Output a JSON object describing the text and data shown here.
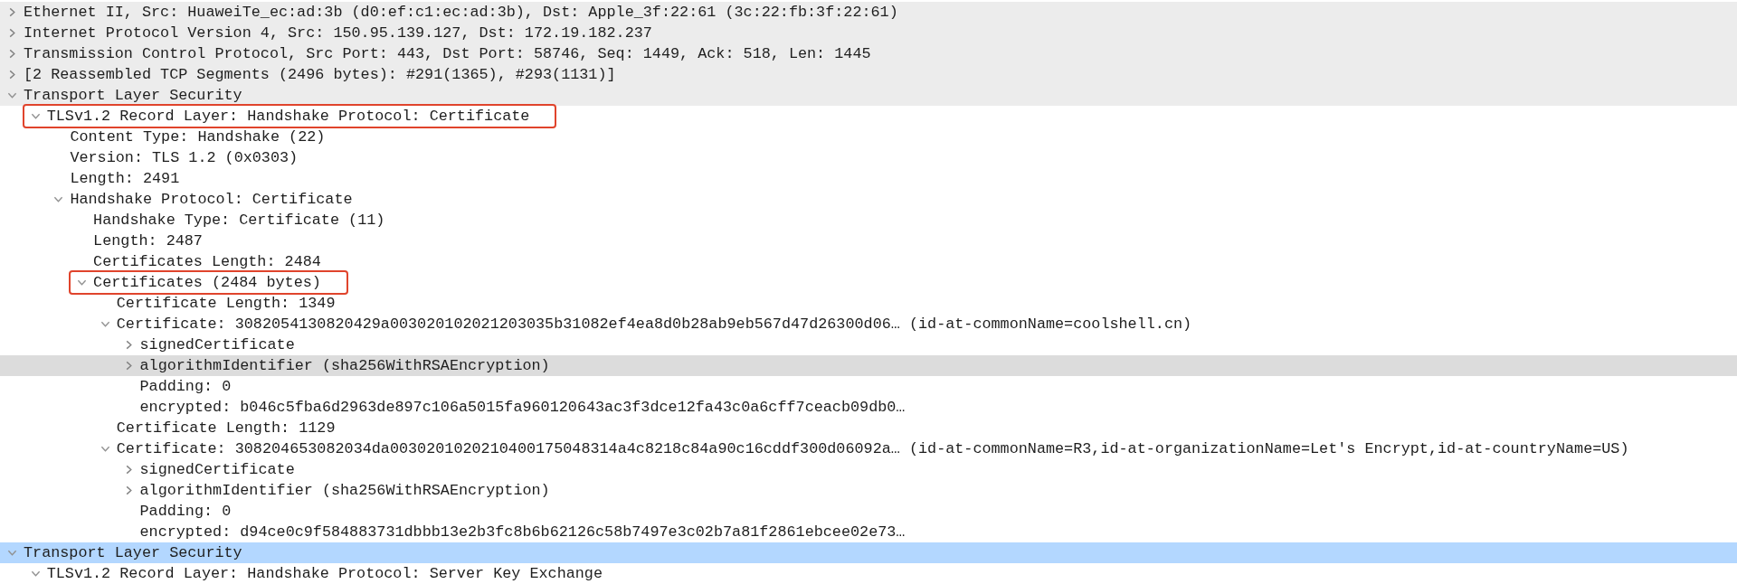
{
  "tree": [
    {
      "text": "Ethernet II, Src: HuaweiTe_ec:ad:3b (d0:ef:c1:ec:ad:3b), Dst: Apple_3f:22:61 (3c:22:fb:3f:22:61)",
      "expanded": false,
      "selected": false
    },
    {
      "text": "Internet Protocol Version 4, Src: 150.95.139.127, Dst: 172.19.182.237",
      "expanded": false,
      "selected": false
    },
    {
      "text": "Transmission Control Protocol, Src Port: 443, Dst Port: 58746, Seq: 1449, Ack: 518, Len: 1445",
      "expanded": false,
      "selected": false
    },
    {
      "text": "[2 Reassembled TCP Segments (2496 bytes): #291(1365), #293(1131)]",
      "expanded": false,
      "selected": false
    },
    {
      "text": "Transport Layer Security",
      "expanded": true,
      "selected": false,
      "children": [
        {
          "text": "TLSv1.2 Record Layer: Handshake Protocol: Certificate",
          "expanded": true,
          "selected": false,
          "annotated": true,
          "children": [
            {
              "text": "Content Type: Handshake (22)",
              "selected": false
            },
            {
              "text": "Version: TLS 1.2 (0x0303)",
              "selected": false
            },
            {
              "text": "Length: 2491",
              "selected": false
            },
            {
              "text": "Handshake Protocol: Certificate",
              "expanded": true,
              "selected": false,
              "children": [
                {
                  "text": "Handshake Type: Certificate (11)",
                  "selected": false
                },
                {
                  "text": "Length: 2487",
                  "selected": false
                },
                {
                  "text": "Certificates Length: 2484",
                  "selected": false
                },
                {
                  "text": "Certificates (2484 bytes)",
                  "expanded": true,
                  "selected": false,
                  "annotated": true,
                  "children": [
                    {
                      "text": "Certificate Length: 1349",
                      "selected": false
                    },
                    {
                      "text": "Certificate: 3082054130820429a003020102021203035b31082ef4ea8d0b28ab9eb567d47d26300d06… (id-at-commonName=coolshell.cn)",
                      "expanded": true,
                      "selected": false,
                      "children": [
                        {
                          "text": "signedCertificate",
                          "expanded": false,
                          "selected": false
                        },
                        {
                          "text": "algorithmIdentifier (sha256WithRSAEncryption)",
                          "expanded": false,
                          "selected": false,
                          "highlighted": true
                        },
                        {
                          "text": "Padding: 0",
                          "selected": false
                        },
                        {
                          "text": "encrypted: b046c5fba6d2963de897c106a5015fa960120643ac3f3dce12fa43c0a6cff7ceacb09db0…",
                          "selected": false
                        }
                      ]
                    },
                    {
                      "text": "Certificate Length: 1129",
                      "selected": false
                    },
                    {
                      "text": "Certificate: 308204653082034da0030201020210400175048314a4c8218c84a90c16cddf300d06092a… (id-at-commonName=R3,id-at-organizationName=Let's Encrypt,id-at-countryName=US)",
                      "expanded": true,
                      "selected": false,
                      "children": [
                        {
                          "text": "signedCertificate",
                          "expanded": false,
                          "selected": false
                        },
                        {
                          "text": "algorithmIdentifier (sha256WithRSAEncryption)",
                          "expanded": false,
                          "selected": false
                        },
                        {
                          "text": "Padding: 0",
                          "selected": false
                        },
                        {
                          "text": "encrypted: d94ce0c9f584883731dbbb13e2b3fc8b6b62126c58b7497e3c02b7a81f2861ebcee02e73…",
                          "selected": false
                        }
                      ]
                    }
                  ]
                }
              ]
            }
          ]
        }
      ]
    },
    {
      "text": "Transport Layer Security",
      "expanded": true,
      "selected": true,
      "children": [
        {
          "text": "TLSv1.2 Record Layer: Handshake Protocol: Server Key Exchange",
          "expanded": true,
          "selected": false
        }
      ]
    }
  ]
}
